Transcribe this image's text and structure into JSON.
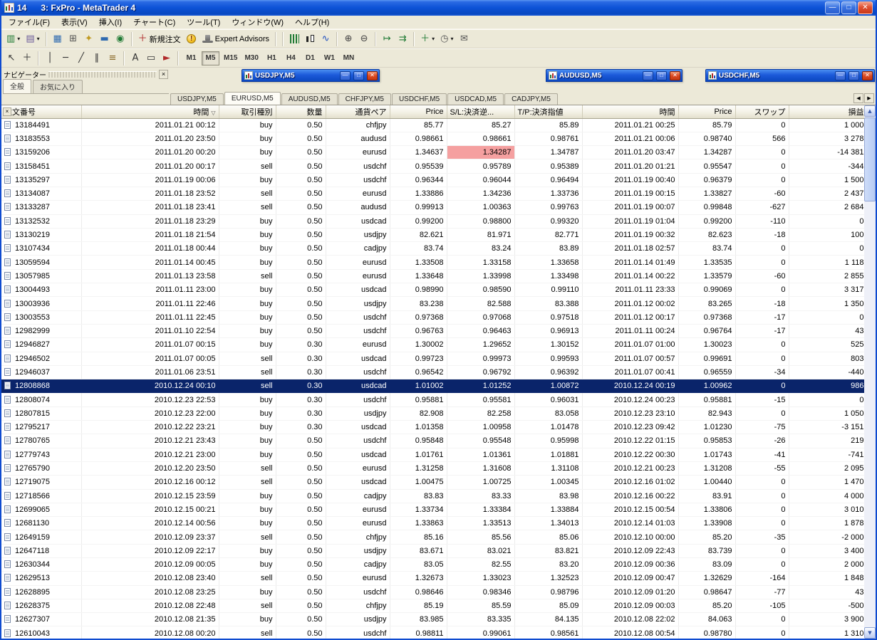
{
  "window": {
    "badge": "14",
    "title": "3: FxPro - MetaTrader 4",
    "controls": {
      "minimize": "—",
      "maximize": "□",
      "close": "✕"
    }
  },
  "icons": {
    "dropdown": "▾"
  },
  "menu": {
    "items": [
      {
        "name": "file",
        "label": "ファイル(F)"
      },
      {
        "name": "view",
        "label": "表示(V)"
      },
      {
        "name": "insert",
        "label": "挿入(I)"
      },
      {
        "name": "charts",
        "label": "チャート(C)"
      },
      {
        "name": "tools",
        "label": "ツール(T)"
      },
      {
        "name": "window",
        "label": "ウィンドウ(W)"
      },
      {
        "name": "help",
        "label": "ヘルプ(H)"
      }
    ]
  },
  "toolbar_standard": [
    {
      "name": "new-chart-button",
      "glyph": "▥",
      "color": "#1f7a34",
      "dropdown": true
    },
    {
      "name": "profiles-button",
      "glyph": "▤",
      "color": "#6a5a9a",
      "dropdown": true
    },
    {
      "sep": true
    },
    {
      "name": "market-watch-button",
      "glyph": "▦",
      "color": "#2f6ab0"
    },
    {
      "name": "data-window-button",
      "glyph": "⊞",
      "color": "#555555"
    },
    {
      "name": "navigator-button",
      "glyph": "✦",
      "color": "#c09a20"
    },
    {
      "name": "terminal-button",
      "glyph": "▬",
      "color": "#2f6ab0"
    },
    {
      "name": "strategy-tester-button",
      "glyph": "◉",
      "color": "#1f7a34"
    },
    {
      "sep": true
    },
    {
      "name": "new-order-button",
      "glyph": "＋",
      "color": "#b02a2a",
      "label": "新規注文"
    },
    {
      "name": "metaeditor-button",
      "css": "ico-alert",
      "text": "!"
    },
    {
      "name": "expert-advisors-button",
      "css": "ico-hat",
      "label": "Expert Advisors"
    },
    {
      "sep": true
    },
    {
      "sep": true
    },
    {
      "name": "bar-chart-button",
      "css": "ico-bars"
    },
    {
      "name": "candlestick-chart-button",
      "css": "ico-candles"
    },
    {
      "name": "line-chart-button",
      "glyph": "∿",
      "color": "#2050c0"
    },
    {
      "sep": true
    },
    {
      "name": "zoom-in-button",
      "glyph": "⊕",
      "color": "#444444"
    },
    {
      "name": "zoom-out-button",
      "glyph": "⊖",
      "color": "#444444"
    },
    {
      "sep": true
    },
    {
      "name": "auto-scroll-button",
      "glyph": "↦",
      "color": "#1f7a34"
    },
    {
      "name": "chart-shift-button",
      "glyph": "⇉",
      "color": "#1f7a34"
    },
    {
      "sep": true
    },
    {
      "name": "indicators-button",
      "glyph": "＋",
      "color": "#1f7a34",
      "dropdown": true
    },
    {
      "name": "periods-button",
      "glyph": "◷",
      "color": "#555555",
      "dropdown": true
    },
    {
      "name": "templates-button",
      "glyph": "✉",
      "color": "#555555"
    }
  ],
  "toolbar_drawing": [
    {
      "name": "cursor-button",
      "glyph": "↖",
      "color": "#333333"
    },
    {
      "name": "crosshair-button",
      "glyph": "＋",
      "color": "#333333"
    },
    {
      "sep": true
    },
    {
      "name": "vertical-line-button",
      "glyph": "│",
      "color": "#333333"
    },
    {
      "name": "horizontal-line-button",
      "glyph": "─",
      "color": "#333333"
    },
    {
      "name": "trendline-button",
      "glyph": "╱",
      "color": "#333333"
    },
    {
      "name": "channel-button",
      "glyph": "∥",
      "color": "#333333"
    },
    {
      "name": "fibonacci-button",
      "glyph": "≡",
      "color": "#8a6a2a"
    },
    {
      "sep": true
    },
    {
      "name": "text-button",
      "glyph": "A",
      "color": "#333333"
    },
    {
      "name": "text-label-button",
      "glyph": "▭",
      "color": "#333333"
    },
    {
      "name": "arrows-button",
      "glyph": "►",
      "color": "#b02a2a"
    },
    {
      "sep": true
    }
  ],
  "timeframes": {
    "items": [
      "M1",
      "M5",
      "M15",
      "M30",
      "H1",
      "H4",
      "D1",
      "W1",
      "MN"
    ],
    "active": "M5"
  },
  "navigator": {
    "title": "ナビゲーター",
    "close_glyph": "×",
    "tabs": [
      {
        "name": "common",
        "label": "全般",
        "active": true
      },
      {
        "name": "favorites",
        "label": "お気に入り",
        "active": false
      }
    ]
  },
  "chart_windows": [
    {
      "title": "USDJPY,M5"
    },
    {
      "title": "AUDUSD,M5"
    },
    {
      "title": "USDCHF,M5"
    }
  ],
  "symbol_tabs": {
    "items": [
      "USDJPY,M5",
      "EURUSD,M5",
      "AUDUSD,M5",
      "CHFJPY,M5",
      "USDCHF,M5",
      "USDCAD,M5",
      "CADJPY,M5"
    ],
    "active": "EURUSD,M5",
    "scroll_left": "◀",
    "scroll_right": "▶"
  },
  "scrollbar": {
    "up": "▲",
    "down": "▼"
  },
  "colors": {
    "caption_blue": "#0c52d6",
    "selected_row": "#0a246a",
    "sl_alert_bg": "#f5a0a0",
    "toolbar_bg": "#ece9d8"
  },
  "table": {
    "close_glyph": "×",
    "columns": [
      {
        "key": "order",
        "label": "注文番号",
        "align": "left"
      },
      {
        "key": "open-time",
        "label": "時間",
        "align": "right",
        "sort": "▽"
      },
      {
        "key": "type",
        "label": "取引種別",
        "align": "right"
      },
      {
        "key": "volume",
        "label": "数量",
        "align": "right"
      },
      {
        "key": "symbol",
        "label": "通貨ペア",
        "align": "right"
      },
      {
        "key": "open-price",
        "label": "Price",
        "align": "right"
      },
      {
        "key": "sl",
        "label": "S/L:決済逆...",
        "align": "left"
      },
      {
        "key": "tp",
        "label": "T/P:決済指値",
        "align": "left"
      },
      {
        "key": "close-time",
        "label": "時間",
        "align": "right"
      },
      {
        "key": "close-price",
        "label": "Price",
        "align": "right"
      },
      {
        "key": "swap",
        "label": "スワップ",
        "align": "right"
      },
      {
        "key": "profit",
        "label": "損益",
        "align": "right"
      }
    ],
    "selected_order": "12808868",
    "sl_alert_order": "13159206",
    "sl_alert_col": 6,
    "rows": [
      [
        "13184491",
        "2011.01.21 00:12",
        "buy",
        "0.50",
        "chfjpy",
        "85.77",
        "85.27",
        "85.89",
        "2011.01.21 00:25",
        "85.79",
        "0",
        "1 000"
      ],
      [
        "13183553",
        "2011.01.20 23:50",
        "buy",
        "0.50",
        "audusd",
        "0.98661",
        "0.98661",
        "0.98761",
        "2011.01.21 00:06",
        "0.98740",
        "566",
        "3 278"
      ],
      [
        "13159206",
        "2011.01.20 00:20",
        "buy",
        "0.50",
        "eurusd",
        "1.34637",
        "1.34287",
        "1.34787",
        "2011.01.20 03:47",
        "1.34287",
        "0",
        "-14 381"
      ],
      [
        "13158451",
        "2011.01.20 00:17",
        "sell",
        "0.50",
        "usdchf",
        "0.95539",
        "0.95789",
        "0.95389",
        "2011.01.20 01:21",
        "0.95547",
        "0",
        "-344"
      ],
      [
        "13135297",
        "2011.01.19 00:06",
        "buy",
        "0.50",
        "usdchf",
        "0.96344",
        "0.96044",
        "0.96494",
        "2011.01.19 00:40",
        "0.96379",
        "0",
        "1 500"
      ],
      [
        "13134087",
        "2011.01.18 23:52",
        "sell",
        "0.50",
        "eurusd",
        "1.33886",
        "1.34236",
        "1.33736",
        "2011.01.19 00:15",
        "1.33827",
        "-60",
        "2 437"
      ],
      [
        "13133287",
        "2011.01.18 23:41",
        "sell",
        "0.50",
        "audusd",
        "0.99913",
        "1.00363",
        "0.99763",
        "2011.01.19 00:07",
        "0.99848",
        "-627",
        "2 684"
      ],
      [
        "13132532",
        "2011.01.18 23:29",
        "buy",
        "0.50",
        "usdcad",
        "0.99200",
        "0.98800",
        "0.99320",
        "2011.01.19 01:04",
        "0.99200",
        "-110",
        "0"
      ],
      [
        "13130219",
        "2011.01.18 21:54",
        "buy",
        "0.50",
        "usdjpy",
        "82.621",
        "81.971",
        "82.771",
        "2011.01.19 00:32",
        "82.623",
        "-18",
        "100"
      ],
      [
        "13107434",
        "2011.01.18 00:44",
        "buy",
        "0.50",
        "cadjpy",
        "83.74",
        "83.24",
        "83.89",
        "2011.01.18 02:57",
        "83.74",
        "0",
        "0"
      ],
      [
        "13059594",
        "2011.01.14 00:45",
        "buy",
        "0.50",
        "eurusd",
        "1.33508",
        "1.33158",
        "1.33658",
        "2011.01.14 01:49",
        "1.33535",
        "0",
        "1 118"
      ],
      [
        "13057985",
        "2011.01.13 23:58",
        "sell",
        "0.50",
        "eurusd",
        "1.33648",
        "1.33998",
        "1.33498",
        "2011.01.14 00:22",
        "1.33579",
        "-60",
        "2 855"
      ],
      [
        "13004493",
        "2011.01.11 23:00",
        "buy",
        "0.50",
        "usdcad",
        "0.98990",
        "0.98590",
        "0.99110",
        "2011.01.11 23:33",
        "0.99069",
        "0",
        "3 317"
      ],
      [
        "13003936",
        "2011.01.11 22:46",
        "buy",
        "0.50",
        "usdjpy",
        "83.238",
        "82.588",
        "83.388",
        "2011.01.12 00:02",
        "83.265",
        "-18",
        "1 350"
      ],
      [
        "13003553",
        "2011.01.11 22:45",
        "buy",
        "0.50",
        "usdchf",
        "0.97368",
        "0.97068",
        "0.97518",
        "2011.01.12 00:17",
        "0.97368",
        "-17",
        "0"
      ],
      [
        "12982999",
        "2011.01.10 22:54",
        "buy",
        "0.50",
        "usdchf",
        "0.96763",
        "0.96463",
        "0.96913",
        "2011.01.11 00:24",
        "0.96764",
        "-17",
        "43"
      ],
      [
        "12946827",
        "2011.01.07 00:15",
        "buy",
        "0.30",
        "eurusd",
        "1.30002",
        "1.29652",
        "1.30152",
        "2011.01.07 01:00",
        "1.30023",
        "0",
        "525"
      ],
      [
        "12946502",
        "2011.01.07 00:05",
        "sell",
        "0.30",
        "usdcad",
        "0.99723",
        "0.99973",
        "0.99593",
        "2011.01.07 00:57",
        "0.99691",
        "0",
        "803"
      ],
      [
        "12946037",
        "2011.01.06 23:51",
        "sell",
        "0.30",
        "usdchf",
        "0.96542",
        "0.96792",
        "0.96392",
        "2011.01.07 00:41",
        "0.96559",
        "-34",
        "-440"
      ],
      [
        "12808868",
        "2010.12.24 00:10",
        "sell",
        "0.30",
        "usdcad",
        "1.01002",
        "1.01252",
        "1.00872",
        "2010.12.24 00:19",
        "1.00962",
        "0",
        "986"
      ],
      [
        "12808074",
        "2010.12.23 22:53",
        "buy",
        "0.30",
        "usdchf",
        "0.95881",
        "0.95581",
        "0.96031",
        "2010.12.24 00:23",
        "0.95881",
        "-15",
        "0"
      ],
      [
        "12807815",
        "2010.12.23 22:00",
        "buy",
        "0.30",
        "usdjpy",
        "82.908",
        "82.258",
        "83.058",
        "2010.12.23 23:10",
        "82.943",
        "0",
        "1 050"
      ],
      [
        "12795217",
        "2010.12.22 23:21",
        "buy",
        "0.30",
        "usdcad",
        "1.01358",
        "1.00958",
        "1.01478",
        "2010.12.23 09:42",
        "1.01230",
        "-75",
        "-3 151"
      ],
      [
        "12780765",
        "2010.12.21 23:43",
        "buy",
        "0.50",
        "usdchf",
        "0.95848",
        "0.95548",
        "0.95998",
        "2010.12.22 01:15",
        "0.95853",
        "-26",
        "219"
      ],
      [
        "12779743",
        "2010.12.21 23:00",
        "buy",
        "0.50",
        "usdcad",
        "1.01761",
        "1.01361",
        "1.01881",
        "2010.12.22 00:30",
        "1.01743",
        "-41",
        "-741"
      ],
      [
        "12765790",
        "2010.12.20 23:50",
        "sell",
        "0.50",
        "eurusd",
        "1.31258",
        "1.31608",
        "1.31108",
        "2010.12.21 00:23",
        "1.31208",
        "-55",
        "2 095"
      ],
      [
        "12719075",
        "2010.12.16 00:12",
        "sell",
        "0.50",
        "usdcad",
        "1.00475",
        "1.00725",
        "1.00345",
        "2010.12.16 01:02",
        "1.00440",
        "0",
        "1 470"
      ],
      [
        "12718566",
        "2010.12.15 23:59",
        "buy",
        "0.50",
        "cadjpy",
        "83.83",
        "83.33",
        "83.98",
        "2010.12.16 00:22",
        "83.91",
        "0",
        "4 000"
      ],
      [
        "12699065",
        "2010.12.15 00:21",
        "buy",
        "0.50",
        "eurusd",
        "1.33734",
        "1.33384",
        "1.33884",
        "2010.12.15 00:54",
        "1.33806",
        "0",
        "3 010"
      ],
      [
        "12681130",
        "2010.12.14 00:56",
        "buy",
        "0.50",
        "eurusd",
        "1.33863",
        "1.33513",
        "1.34013",
        "2010.12.14 01:03",
        "1.33908",
        "0",
        "1 878"
      ],
      [
        "12649159",
        "2010.12.09 23:37",
        "sell",
        "0.50",
        "chfjpy",
        "85.16",
        "85.56",
        "85.06",
        "2010.12.10 00:00",
        "85.20",
        "-35",
        "-2 000"
      ],
      [
        "12647118",
        "2010.12.09 22:17",
        "buy",
        "0.50",
        "usdjpy",
        "83.671",
        "83.021",
        "83.821",
        "2010.12.09 22:43",
        "83.739",
        "0",
        "3 400"
      ],
      [
        "12630344",
        "2010.12.09 00:05",
        "buy",
        "0.50",
        "cadjpy",
        "83.05",
        "82.55",
        "83.20",
        "2010.12.09 00:36",
        "83.09",
        "0",
        "2 000"
      ],
      [
        "12629513",
        "2010.12.08 23:40",
        "sell",
        "0.50",
        "eurusd",
        "1.32673",
        "1.33023",
        "1.32523",
        "2010.12.09 00:47",
        "1.32629",
        "-164",
        "1 848"
      ],
      [
        "12628895",
        "2010.12.08 23:25",
        "buy",
        "0.50",
        "usdchf",
        "0.98646",
        "0.98346",
        "0.98796",
        "2010.12.09 01:20",
        "0.98647",
        "-77",
        "43"
      ],
      [
        "12628375",
        "2010.12.08 22:48",
        "sell",
        "0.50",
        "chfjpy",
        "85.19",
        "85.59",
        "85.09",
        "2010.12.09 00:03",
        "85.20",
        "-105",
        "-500"
      ],
      [
        "12627307",
        "2010.12.08 21:35",
        "buy",
        "0.50",
        "usdjpy",
        "83.985",
        "83.335",
        "84.135",
        "2010.12.08 22:02",
        "84.063",
        "0",
        "3 900"
      ],
      [
        "12610043",
        "2010.12.08 00:20",
        "sell",
        "0.50",
        "usdchf",
        "0.98811",
        "0.99061",
        "0.98561",
        "2010.12.08 00:54",
        "0.98780",
        "0",
        "1 310"
      ]
    ]
  }
}
